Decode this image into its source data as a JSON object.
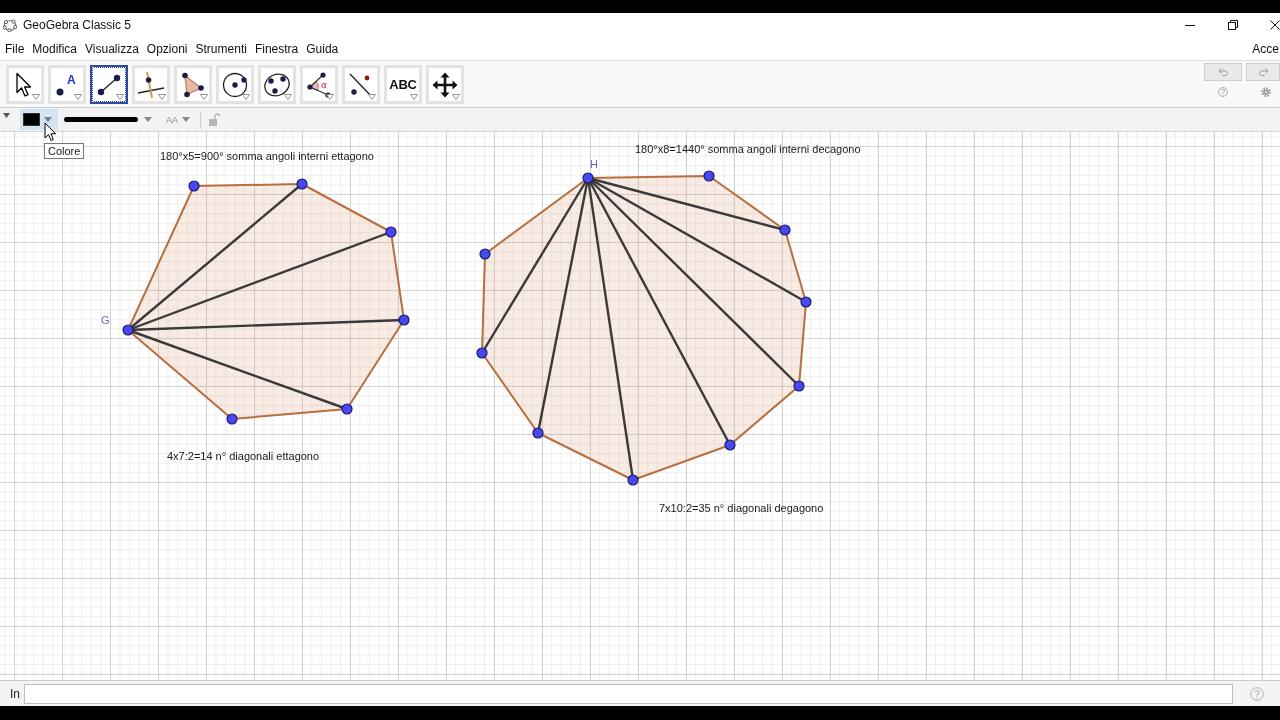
{
  "window": {
    "title": "GeoGebra Classic 5"
  },
  "menu_bar": {
    "items": [
      "File",
      "Modifica",
      "Visualizza",
      "Opzioni",
      "Strumenti",
      "Finestra",
      "Guida"
    ],
    "sign_in": "Acce"
  },
  "toolbar": {
    "tools": [
      {
        "kind": "move",
        "selected": false
      },
      {
        "kind": "point",
        "icon_text": "A",
        "selected": false
      },
      {
        "kind": "segment",
        "selected": true
      },
      {
        "kind": "perpendicular",
        "selected": false
      },
      {
        "kind": "polygon",
        "selected": false
      },
      {
        "kind": "circle",
        "selected": false
      },
      {
        "kind": "conic",
        "selected": false
      },
      {
        "kind": "angle",
        "icon_text": "α",
        "selected": false
      },
      {
        "kind": "reflect",
        "selected": false
      },
      {
        "kind": "text",
        "label": "ABC",
        "selected": false
      },
      {
        "kind": "move_view",
        "selected": false
      }
    ]
  },
  "style_bar": {
    "text_size": "AA",
    "tooltip": "Colore"
  },
  "graphics_view": {
    "polygons": [
      {
        "kind": "heptagon",
        "vertex_label": "G"
      },
      {
        "kind": "decagon",
        "vertex_label": "H"
      }
    ],
    "texts": [
      "180°x5=900° somma angoli interni ettagono",
      "180°x8=1440° somma angoli interni decagono",
      "4x7:2=14 n° diagonali ettagono",
      "7x10:2=35 n° diagonali degagono"
    ]
  },
  "input_bar": {
    "label": "In"
  }
}
